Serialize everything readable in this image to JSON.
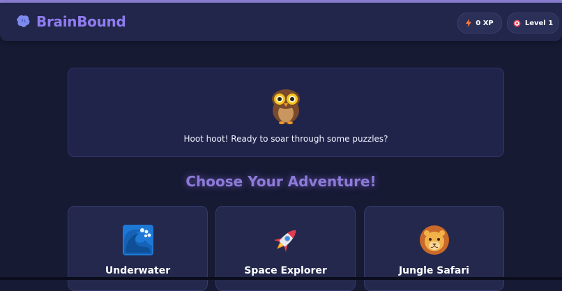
{
  "header": {
    "brand_name": "BrainBound",
    "brand_icon": "brain-icon",
    "xp_label": "0 XP",
    "xp_icon": "lightning-icon",
    "level_label": "Level 1",
    "level_icon": "target-icon"
  },
  "mascot": {
    "icon": "owl-icon",
    "message": "Hoot hoot! Ready to soar through some puzzles?"
  },
  "adventures": {
    "title": "Choose Your Adventure!",
    "items": [
      {
        "label": "Underwater",
        "icon": "wave-icon"
      },
      {
        "label": "Space Explorer",
        "icon": "rocket-icon"
      },
      {
        "label": "Jungle Safari",
        "icon": "lion-icon"
      }
    ]
  },
  "colors": {
    "background": "#171a33",
    "header": "#22264a",
    "brand": "#8f7cf0",
    "accent": "#8d7ad8"
  }
}
